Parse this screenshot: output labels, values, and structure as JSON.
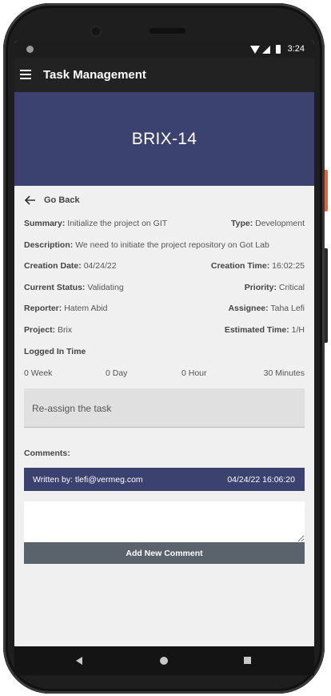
{
  "status_bar": {
    "time": "3:24"
  },
  "app_bar": {
    "title": "Task Management",
    "menu_icon": "hamburger-menu-icon"
  },
  "task": {
    "key": "BRIX-14",
    "go_back_label": "Go Back",
    "summary_label": "Summary:",
    "summary_value": "Initialize the project on GIT",
    "type_label": "Type:",
    "type_value": "Development",
    "description_label": "Description:",
    "description_value": "We need to initiate the project repository on Got Lab",
    "creation_date_label": "Creation Date:",
    "creation_date_value": "04/24/22",
    "creation_time_label": "Creation Time:",
    "creation_time_value": "16:02:25",
    "status_label": "Current Status:",
    "status_value": "Validating",
    "priority_label": "Priority:",
    "priority_value": "Critical",
    "reporter_label": "Reporter:",
    "reporter_value": "Hatem Abid",
    "assignee_label": "Assignee:",
    "assignee_value": "Taha Lefi",
    "project_label": "Project:",
    "project_value": "Brix",
    "estimated_label": "Estimated Time:",
    "estimated_value": "1/H"
  },
  "logged_time": {
    "title": "Logged In Time",
    "week": "0 Week",
    "day": "0 Day",
    "hour": "0 Hour",
    "minutes": "30 Minutes"
  },
  "reassign_label": "Re-assign the task",
  "comments": {
    "title": "Comments:",
    "items": [
      {
        "author": "Written by: tlefi@vermeg.com",
        "date": "04/24/22 16:06:20"
      }
    ],
    "input_value": "",
    "add_button_label": "Add New Comment"
  },
  "colors": {
    "accent": "#3b4270",
    "appbar": "#222222",
    "button": "#5a626c"
  }
}
